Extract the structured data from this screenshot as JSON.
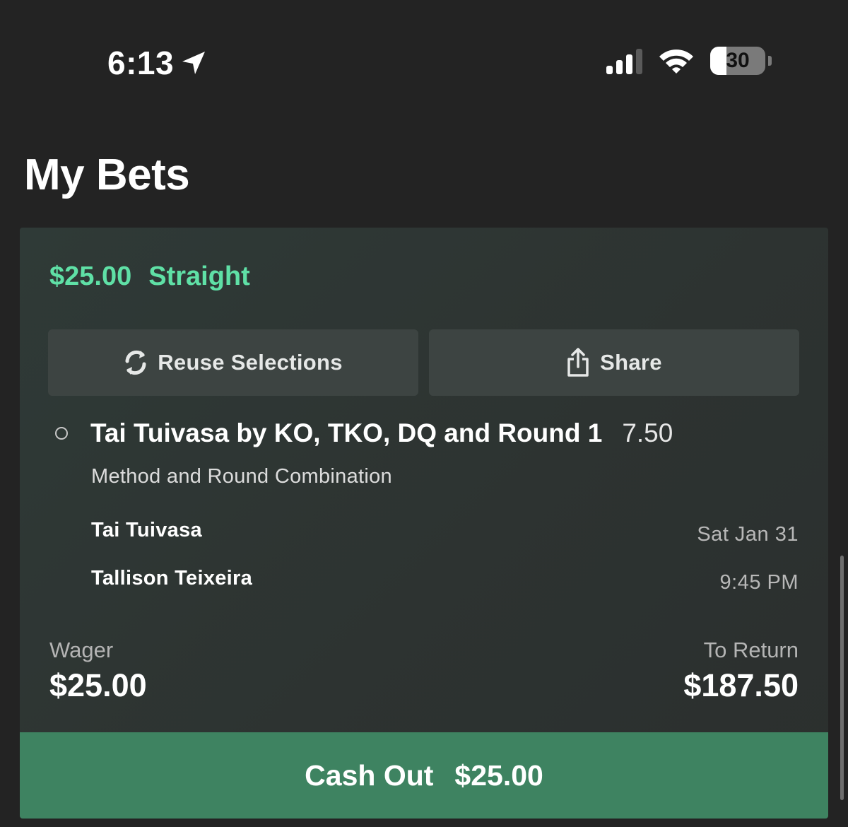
{
  "status_bar": {
    "time": "6:13",
    "battery_level": "30",
    "battery_fraction": 0.3,
    "signal_bars_active": 3,
    "signal_bars_total": 4
  },
  "page": {
    "title": "My Bets"
  },
  "bet": {
    "stake": "$25.00",
    "bet_type": "Straight",
    "accent_color": "#5fe0a6",
    "actions": {
      "reuse_label": "Reuse Selections",
      "share_label": "Share"
    },
    "selection": {
      "title": "Tai Tuivasa by KO, TKO, DQ and Round 1",
      "odds": "7.50",
      "market": "Method and Round Combination"
    },
    "event": {
      "competitor_1": "Tai Tuivasa",
      "competitor_2": "Tallison Teixeira",
      "date": "Sat Jan 31",
      "time": "9:45 PM"
    },
    "wager_label": "Wager",
    "wager_value": "$25.00",
    "return_label": "To Return",
    "return_value": "$187.50",
    "cashout": {
      "label": "Cash Out",
      "amount": "$25.00",
      "color": "#3e8361"
    }
  }
}
